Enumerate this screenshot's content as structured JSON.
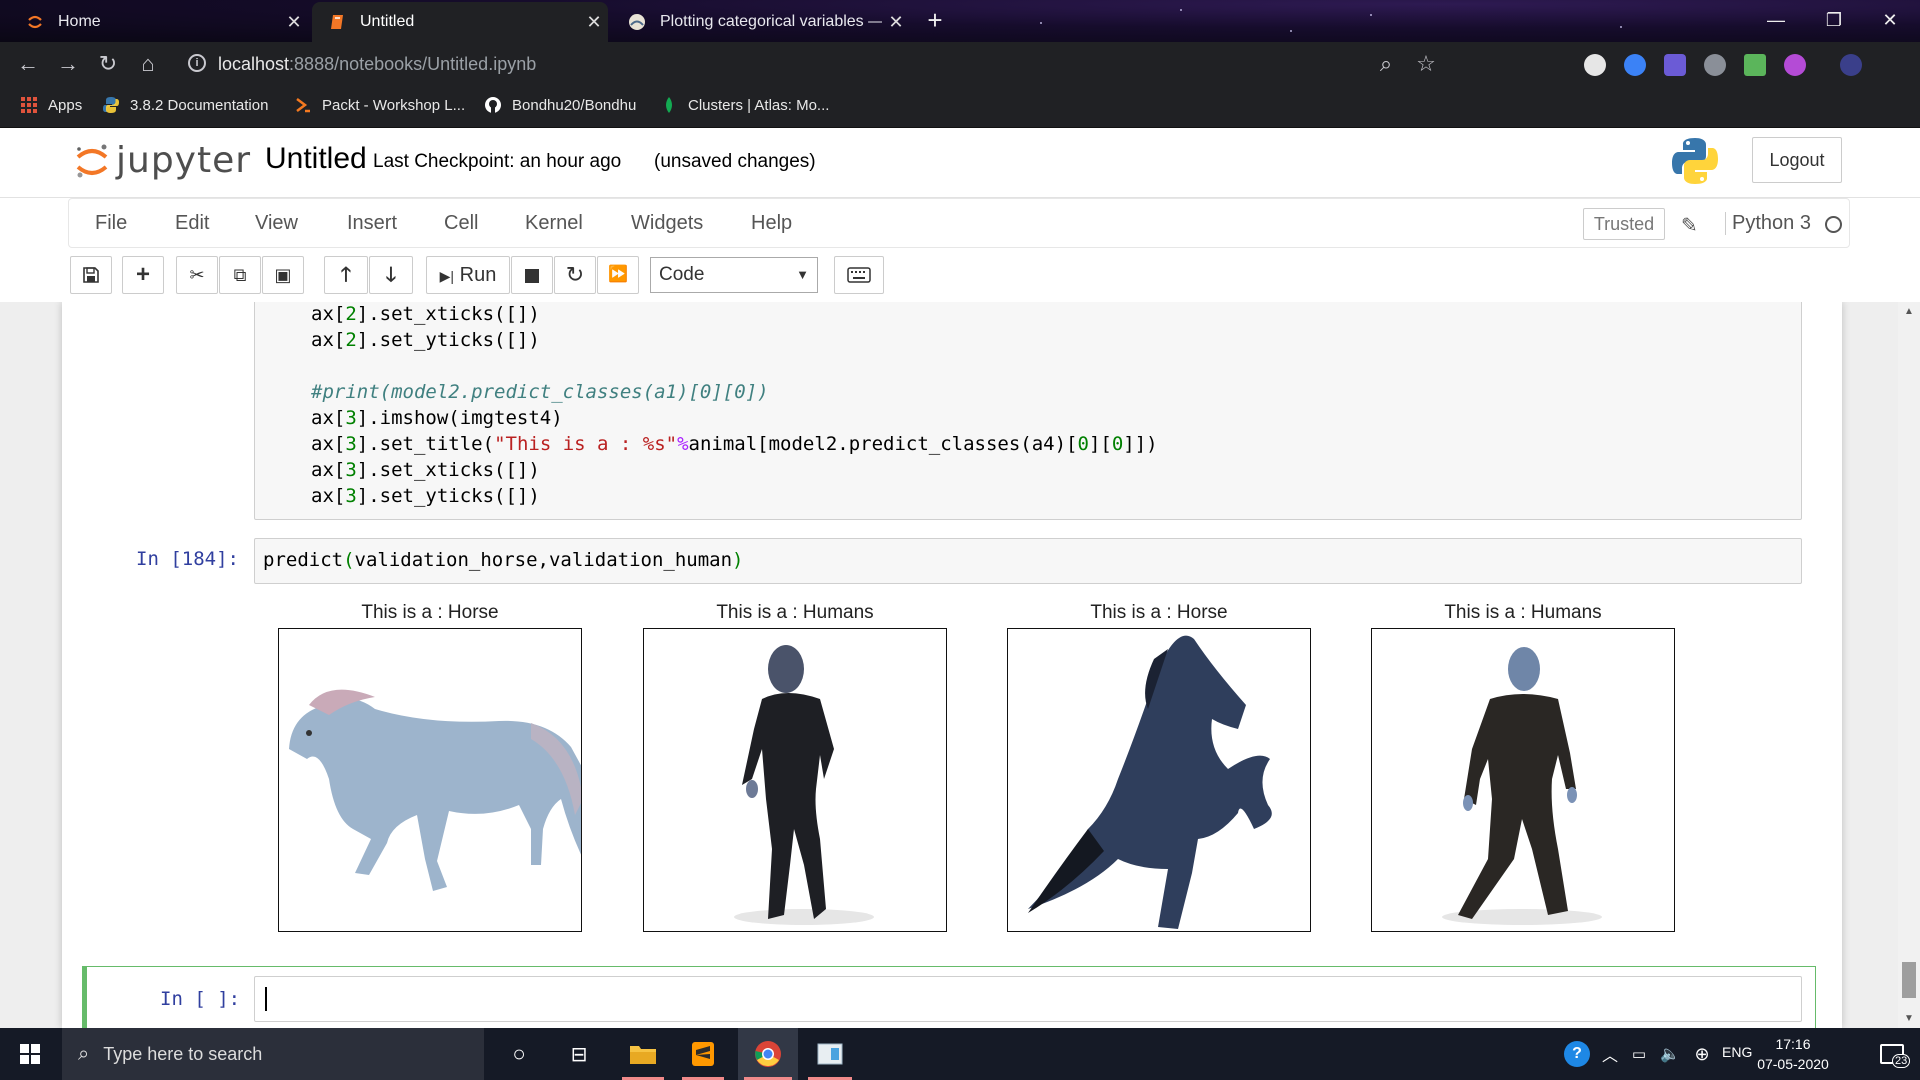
{
  "browser": {
    "tabs": [
      {
        "label": "Home",
        "active": false
      },
      {
        "label": "Untitled",
        "active": true
      },
      {
        "label": "Plotting categorical variables — ",
        "active": false
      }
    ],
    "url_host": "localhost",
    "url_rest": ":8888/notebooks/Untitled.ipynb",
    "bookmarks": [
      {
        "label": "Apps"
      },
      {
        "label": "3.8.2 Documentation"
      },
      {
        "label": "Packt - Workshop L..."
      },
      {
        "label": "Bondhu20/Bondhu"
      },
      {
        "label": "Clusters | Atlas: Mo..."
      }
    ]
  },
  "jupyter": {
    "logo_text": "jupyter",
    "notebook_title": "Untitled",
    "checkpoint": "Last Checkpoint: an hour ago",
    "unsaved": "(unsaved changes)",
    "logout_label": "Logout",
    "menus": [
      "File",
      "Edit",
      "View",
      "Insert",
      "Cell",
      "Kernel",
      "Widgets",
      "Help"
    ],
    "trusted_label": "Trusted",
    "kernel_name": "Python 3",
    "toolbar": {
      "run_label": "Run",
      "cell_type": "Code"
    }
  },
  "cells": {
    "prev_code_lines": [
      "ax[2].set_xticks([])",
      "ax[2].set_yticks([])",
      "",
      "#print(model2.predict_classes(a1)[0][0])",
      "ax[3].imshow(imgtest4)",
      "ax[3].set_title(\"This is a : %s\"%animal[model2.predict_classes(a4)[0][0]])",
      "ax[3].set_xticks([])",
      "ax[3].set_yticks([])"
    ],
    "run_prompt": "In [184]:",
    "run_code": "predict(validation_horse,validation_human)",
    "empty_prompt": "In [ ]:",
    "figures": [
      {
        "title": "This is a : Horse",
        "icon": "horse-image"
      },
      {
        "title": "This is a : Humans",
        "icon": "human-image"
      },
      {
        "title": "This is a : Horse",
        "icon": "rearing-horse-image"
      },
      {
        "title": "This is a : Humans",
        "icon": "human-image"
      }
    ]
  },
  "taskbar": {
    "search_placeholder": "Type here to search",
    "language": "ENG",
    "time": "17:16",
    "date": "07-05-2020",
    "notifications": "23"
  },
  "colors": {
    "jupyter_orange": "#f37726",
    "prompt_blue": "#303f9f",
    "active_cell_green": "#66bb6a"
  }
}
